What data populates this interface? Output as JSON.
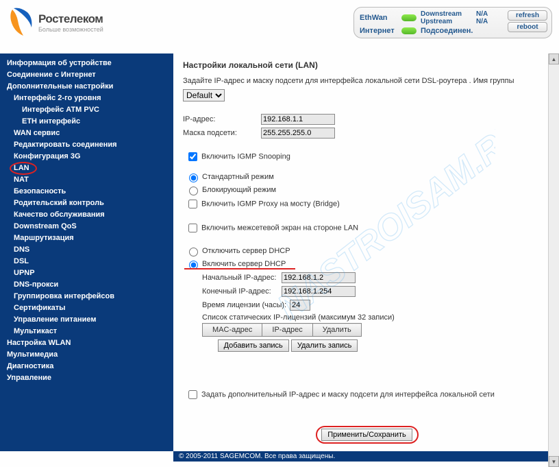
{
  "logo": {
    "brand": "Ростелеком",
    "tagline": "Больше возможностей"
  },
  "status": {
    "ethwan": "EthWan",
    "downstream_l": "Downstream",
    "downstream_v": "N/A",
    "upstream_l": "Upstream",
    "upstream_v": "N/A",
    "internet_l": "Интернет",
    "internet_v": "Подсоединен.",
    "refresh": "refresh",
    "reboot": "reboot"
  },
  "sidebar": [
    {
      "t": "Информация об устройстве",
      "lv": 1
    },
    {
      "t": "Соединение с Интернет",
      "lv": 1
    },
    {
      "t": "Дополнительные настройки",
      "lv": 1
    },
    {
      "t": "Интерфейс 2-го уровня",
      "lv": 2
    },
    {
      "t": "Интерфейс ATM PVC",
      "lv": 3
    },
    {
      "t": "ETH интерфейс",
      "lv": 3
    },
    {
      "t": "WAN сервис",
      "lv": 2
    },
    {
      "t": "Редактировать соединения",
      "lv": 2
    },
    {
      "t": "Конфигурация 3G",
      "lv": 2
    },
    {
      "t": "LAN",
      "lv": 2,
      "circled": true
    },
    {
      "t": "NAT",
      "lv": 2
    },
    {
      "t": "Безопасность",
      "lv": 2
    },
    {
      "t": "Родительский контроль",
      "lv": 2
    },
    {
      "t": "Качество обслуживания",
      "lv": 2
    },
    {
      "t": "Downstream QoS",
      "lv": 2
    },
    {
      "t": "Маршрутизация",
      "lv": 2
    },
    {
      "t": "DNS",
      "lv": 2
    },
    {
      "t": "DSL",
      "lv": 2
    },
    {
      "t": "UPNP",
      "lv": 2
    },
    {
      "t": "DNS-прокси",
      "lv": 2
    },
    {
      "t": "Группировка интерфейсов",
      "lv": 2
    },
    {
      "t": "Сертификаты",
      "lv": 2
    },
    {
      "t": "Управление питанием",
      "lv": 2
    },
    {
      "t": "Мультикаст",
      "lv": 2
    },
    {
      "t": "Настройка WLAN",
      "lv": 1
    },
    {
      "t": "Мультимедиа",
      "lv": 1
    },
    {
      "t": "Диагностика",
      "lv": 1
    },
    {
      "t": "Управление",
      "lv": 1
    }
  ],
  "page": {
    "title": "Настройки локальной сети (LAN)",
    "desc": "Задайте IP-адрес и маску подсети для интерфейса локальной сети DSL-роутера .  Имя группы",
    "group_option": "Default",
    "ip_label": "IP-адрес:",
    "ip_value": "192.168.1.1",
    "mask_label": "Маска подсети:",
    "mask_value": "255.255.255.0",
    "igmp_snoop": "Включить IGMP Snooping",
    "mode_std": "Стандартный режим",
    "mode_block": "Блокирующий режим",
    "igmp_proxy": "Включить IGMP Proxy на мосту (Bridge)",
    "lan_fw": "Включить межсетевой экран на стороне LAN",
    "dhcp_off": "Отключить сервер DHCP",
    "dhcp_on": "Включить сервер DHCP",
    "dhcp_start_l": "Начальный IP-адрес:",
    "dhcp_start_v": "192.168.1.2",
    "dhcp_end_l": "Конечный IP-адрес:",
    "dhcp_end_v": "192.168.1.254",
    "lease_l": "Время лицензии (часы):",
    "lease_v": "24",
    "static_list": "Список статических IP-лицензий (максимум 32 записи)",
    "th_mac": "MAC-адрес",
    "th_ip": "IP-адрес",
    "th_del": "Удалить",
    "add_rec": "Добавить запись",
    "del_rec": "Удалить запись",
    "extra_ip": "Задать дополнительный IP-адрес и маску подсети для интерфейса локальной сети",
    "apply": "Применить/Сохранить"
  },
  "footer": "© 2005-2011 SAGEMCOM. Все права защищены."
}
